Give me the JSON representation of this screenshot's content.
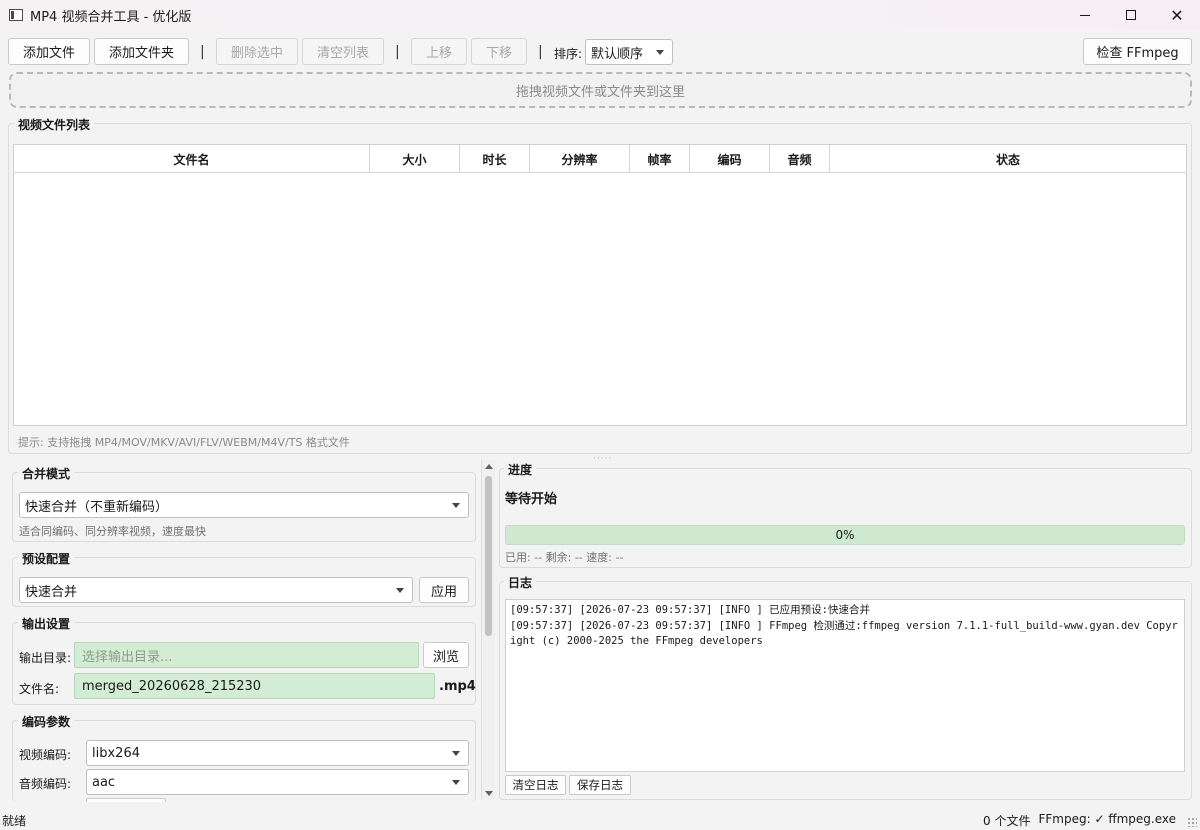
{
  "window": {
    "title": "MP4 视频合并工具 - 优化版"
  },
  "toolbar": {
    "add_file": "添加文件",
    "add_folder": "添加文件夹",
    "separator": "|",
    "delete_selected": "删除选中",
    "clear_list": "清空列表",
    "move_up": "上移",
    "move_down": "下移",
    "sort_label": "排序:",
    "sort_value": "默认顺序",
    "check_ffmpeg": "检查 FFmpeg"
  },
  "dropzone": {
    "text": "拖拽视频文件或文件夹到这里"
  },
  "file_list": {
    "title": "视频文件列表",
    "columns": [
      "文件名",
      "大小",
      "时长",
      "分辨率",
      "帧率",
      "编码",
      "音频",
      "状态"
    ],
    "rows": [],
    "hint": "提示: 支持拖拽 MP4/MOV/MKV/AVI/FLV/WEBM/M4V/TS 格式文件"
  },
  "merge_mode": {
    "title": "合并模式",
    "value": "快速合并（不重新编码）",
    "description": "适合同编码、同分辨率视频，速度最快"
  },
  "preset": {
    "title": "预设配置",
    "value": "快速合并",
    "apply": "应用"
  },
  "output": {
    "title": "输出设置",
    "dir_label": "输出目录:",
    "dir_placeholder": "选择输出目录...",
    "browse": "浏览",
    "name_label": "文件名:",
    "name_value": "merged_20260628_215230",
    "ext": ".mp4"
  },
  "encoding": {
    "title": "编码参数",
    "video_label": "视频编码:",
    "video_value": "libx264",
    "audio_label": "音频编码:",
    "audio_value": "aac"
  },
  "progress": {
    "title": "进度",
    "status": "等待开始",
    "percent": 0,
    "percent_text": "0%",
    "stats": "已用: -- 剩余: -- 速度: --"
  },
  "log": {
    "title": "日志",
    "lines": [
      "[09:57:37] [2026-07-23 09:57:37] [INFO ] 已应用预设:快速合并",
      "[09:57:37] [2026-07-23 09:57:37] [INFO ] FFmpeg 检测通过:ffmpeg version 7.1.1-full_build-www.gyan.dev Copyright (c) 2000-2025 the FFmpeg developers"
    ],
    "clear": "清空日志",
    "save": "保存日志"
  },
  "statusbar": {
    "left": "就绪",
    "file_count": "0 个文件",
    "ffmpeg": "FFmpeg: ✓ ffmpeg.exe"
  },
  "colors": {
    "progress_bg": "#cfe8d0",
    "input_bg": "#d3ecd4",
    "window_bg": "#f3f3f3"
  }
}
